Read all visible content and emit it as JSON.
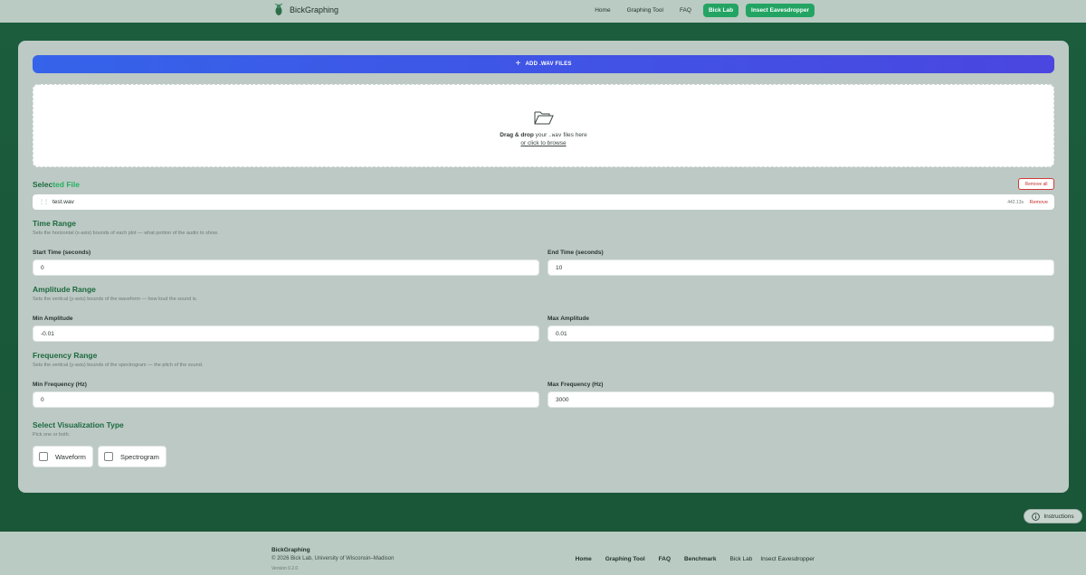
{
  "header": {
    "brand": "BickGraphing",
    "nav": {
      "home": "Home",
      "graphing_tool": "Graphing Tool",
      "faq": "FAQ",
      "bick_lab": "Bick Lab",
      "insect_eavesdropper": "Insect Eavesdropper"
    }
  },
  "upload": {
    "add_button_label": "ADD .WAV FILES",
    "drop_bold": "Drag & drop",
    "drop_your": "your",
    "drop_ext": ".wav",
    "drop_tail": "files here",
    "browse_label": "or click to browse"
  },
  "selected": {
    "title_a": "Selec",
    "title_b": "ted File",
    "remove_all_label": "Remove all",
    "files": [
      {
        "name": "test.wav",
        "duration": "442.13s",
        "remove_label": "Remove"
      }
    ]
  },
  "time_range": {
    "title": "Time Range",
    "description": "Sets the horizontal (x-axis) bounds of each plot — what portion of the audio to show.",
    "start_label": "Start Time (seconds)",
    "start_value": "0",
    "end_label": "End Time (seconds)",
    "end_value": "10"
  },
  "amplitude_range": {
    "title": "Amplitude Range",
    "description": "Sets the vertical (y-axis) bounds of the waveform — how loud the sound is.",
    "min_label": "Min Amplitude",
    "min_value": "-0.01",
    "max_label": "Max Amplitude",
    "max_value": "0.01"
  },
  "frequency_range": {
    "title": "Frequency Range",
    "description": "Sets the vertical (y-axis) bounds of the spectrogram — the pitch of the sound.",
    "min_label": "Min Frequency (Hz)",
    "min_value": "0",
    "max_label": "Max Frequency (Hz)",
    "max_value": "3000"
  },
  "visualization": {
    "title": "Select Visualization Type",
    "description": "Pick one or both.",
    "options": [
      {
        "label": "Waveform",
        "checked": false
      },
      {
        "label": "Spectrogram",
        "checked": false
      }
    ]
  },
  "instructions_label": "Instructions",
  "footer": {
    "brand": "BickGraphing",
    "copyright": "© 2026 Bick Lab, University of Wisconsin–Madison",
    "version": "Version 0.2.0",
    "links": {
      "home": "Home",
      "graphing_tool": "Graphing Tool",
      "faq": "FAQ",
      "benchmark": "Benchmark",
      "bick_lab": "Bick Lab",
      "insect_eavesdropper": "Insect Eavesdropper"
    }
  },
  "colors": {
    "band_green": "#1b5d3d",
    "accent_green": "#23a463",
    "primary_blue": "#3563ea",
    "danger_red": "#c53030"
  }
}
